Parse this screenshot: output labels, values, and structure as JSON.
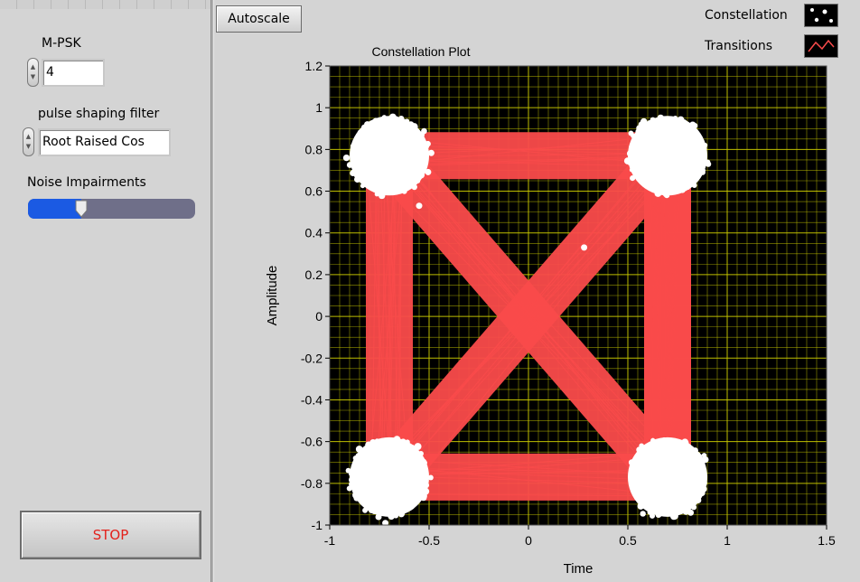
{
  "controls": {
    "mpsk_label": "M-PSK",
    "mpsk_value": "4",
    "filter_label": "pulse shaping filter",
    "filter_value": "Root Raised Cos",
    "noise_label": "Noise Impairments",
    "noise_level": 0.32,
    "stop_label": "STOP"
  },
  "toolbar": {
    "autoscale_label": "Autoscale"
  },
  "legend": {
    "constellation_label": "Constellation",
    "transitions_label": "Transitions"
  },
  "colors": {
    "plot_bg": "#000000",
    "grid": "#c8c800",
    "transitions": "#fa4b4b",
    "constellation": "#ffffff",
    "slider_fill": "#1b5ae3"
  },
  "chart_data": {
    "type": "scatter",
    "title": "Constellation Plot",
    "xlabel": "Time",
    "ylabel": "Amplitude",
    "xlim": [
      -1,
      1.5
    ],
    "ylim": [
      -1,
      1.2
    ],
    "xticks": [
      "-1",
      "-0.5",
      "0",
      "0.5",
      "1",
      "1.5"
    ],
    "yticks": [
      "1.2",
      "1",
      "0.8",
      "0.6",
      "0.4",
      "0.2",
      "0",
      "-0.2",
      "-0.4",
      "-0.6",
      "-0.8",
      "-1"
    ],
    "grid": true,
    "series": [
      {
        "name": "Constellation",
        "points": [
          [
            -0.7,
            0.77
          ],
          [
            0.7,
            0.77
          ],
          [
            -0.7,
            -0.77
          ],
          [
            0.7,
            -0.77
          ]
        ]
      },
      {
        "name": "Transitions",
        "points": [
          [
            -0.7,
            0.77
          ],
          [
            0.7,
            0.77
          ],
          [
            0.7,
            -0.77
          ],
          [
            -0.7,
            -0.77
          ],
          [
            -0.7,
            0.77
          ],
          [
            0.7,
            -0.77
          ],
          [
            0.7,
            0.77
          ],
          [
            -0.7,
            -0.77
          ]
        ]
      }
    ]
  }
}
